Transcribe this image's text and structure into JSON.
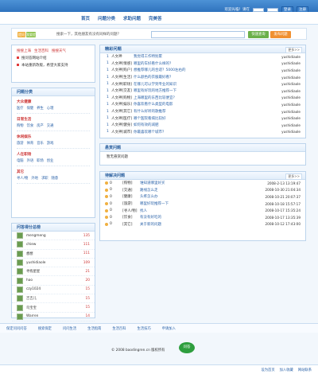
{
  "topbar": {
    "text": "欢迎光临！请在",
    "login": "登录",
    "register": "注册"
  },
  "nav": {
    "items": [
      "首页",
      "问题分类",
      "求助问题",
      "完美答"
    ]
  },
  "search": {
    "ask_label": "提问",
    "ask_button": "我要提问",
    "hint": "搜索一下，其他朋友有没有同样的问题？",
    "placeholder": "",
    "query_button": "快速查询",
    "post_button": "发布问题"
  },
  "side_top": {
    "links": [
      "搜搜上海",
      "生活百科",
      "搜搜天气"
    ],
    "bullets": [
      "搜问答网站介绍",
      "本站重新改版，希望大家支持"
    ]
  },
  "categories": {
    "title": "问题分类",
    "groups": [
      {
        "name": "大众健康",
        "items": [
          "医疗",
          "保健",
          "养生",
          "心理"
        ]
      },
      {
        "name": "日常生活",
        "items": [
          "购物",
          "饮食",
          "房产",
          "交通"
        ]
      },
      {
        "name": "休闲娱乐",
        "items": [
          "旅游",
          "体育",
          "音乐",
          "游戏"
        ]
      },
      {
        "name": "人在职场",
        "items": [
          "电脑",
          "外语",
          "职场",
          "创业"
        ]
      },
      {
        "name": "其它",
        "items": [
          "寻人/物",
          "外地",
          "求职",
          "随意"
        ]
      }
    ]
  },
  "users": {
    "title": "问答得分总榜",
    "list": [
      {
        "name": "mengmeng",
        "score": "135"
      },
      {
        "name": "chiew",
        "score": "111"
      },
      {
        "name": "想想",
        "score": "111"
      },
      {
        "name": "yushidiaole",
        "score": "109"
      },
      {
        "name": "寻找星星",
        "score": "21"
      },
      {
        "name": "hao",
        "score": "20"
      },
      {
        "name": "czy1024",
        "score": "15"
      },
      {
        "name": "吉吉儿",
        "score": "15"
      },
      {
        "name": "鸟宝宝",
        "score": "15"
      },
      {
        "name": "Warren",
        "score": "14"
      }
    ]
  },
  "hot": {
    "title": "精彩问题",
    "more": "更多>>",
    "rows": [
      {
        "n": "1",
        "cat": "人文神",
        "q": "我觉得工作特别累",
        "src": "yushidiaole"
      },
      {
        "n": "1",
        "cat": "人文神[情感]",
        "q": "哪里的车好看什么样的？",
        "src": "yushidiaole"
      },
      {
        "n": "1",
        "cat": "人文神[购户]",
        "q": "想推荐哪儿的合适？5000左右的",
        "src": "yushidiaole"
      },
      {
        "n": "1",
        "cat": "人文神[生活]",
        "q": "什么颜色的衣服最好看？",
        "src": "yushidiaole"
      },
      {
        "n": "1",
        "cat": "人文神[职场]",
        "q": "在哪儿可以学到专业的知识",
        "src": "yushidiaole"
      },
      {
        "n": "1",
        "cat": "人文神[交友]",
        "q": "哪里有好玩的地方推荐一下",
        "src": "yushidiaole"
      },
      {
        "n": "1",
        "cat": "人文神[购物]",
        "q": "上海哪里的东西比较便宜？",
        "src": "yushidiaole"
      },
      {
        "n": "1",
        "cat": "人文神[娱乐]",
        "q": "你喜欢看什么类型的电影",
        "src": "yushidiaole"
      },
      {
        "n": "1",
        "cat": "人文神[其它]",
        "q": "有什么好听的歌推荐",
        "src": "yushidiaole"
      },
      {
        "n": "1",
        "cat": "人文神[医疗]",
        "q": "哪个医院看病比较好",
        "src": "yushidiaole"
      },
      {
        "n": "1",
        "cat": "人文神[健身]",
        "q": "如何有效的减肥",
        "src": "yushidiaole"
      },
      {
        "n": "1",
        "cat": "人文神[城市]",
        "q": "你最喜欢哪个城市？",
        "src": "yushidiaole"
      }
    ]
  },
  "recommend": {
    "title": "悬赏问题",
    "text": "暂无悬赏问题"
  },
  "pending": {
    "title": "待解决问题",
    "more": "更多>>",
    "rows": [
      {
        "score": "0",
        "cat": "[购物]",
        "q": "谁知道哪里好买",
        "time": "2008-2-13 13:19:47"
      },
      {
        "score": "0",
        "cat": "[交通]",
        "q": "路线怎么走",
        "time": "2008-10-30 21:04:34"
      },
      {
        "score": "0",
        "cat": "[健康]",
        "q": "头疼怎么办",
        "time": "2008-10-21 20:07:37"
      },
      {
        "score": "0",
        "cat": "[旅游]",
        "q": "哪里好玩推荐一下",
        "time": "2008-10-18 15:57:17"
      },
      {
        "score": "0",
        "cat": "[寻人/物]",
        "q": "找人",
        "time": "2008-10-17 15:35:24"
      },
      {
        "score": "0",
        "cat": "[饮食]",
        "q": "有没有好吃的",
        "time": "2008-10-17 13:35:39"
      },
      {
        "score": "0",
        "cat": "[其它]",
        "q": "关于新的问题",
        "time": "2008-10-12 17:43:00"
      }
    ]
  },
  "footer": {
    "links": [
      "保定问问问答",
      "搜索保定",
      "问问生活",
      "生活指南",
      "生活百科",
      "生活技巧",
      "申请加入"
    ],
    "copyright": "© 2008 baodingren.cn 版权所有",
    "logo": "问答",
    "bottom_links": [
      "设为首页",
      "加入收藏",
      "网站联系"
    ]
  }
}
